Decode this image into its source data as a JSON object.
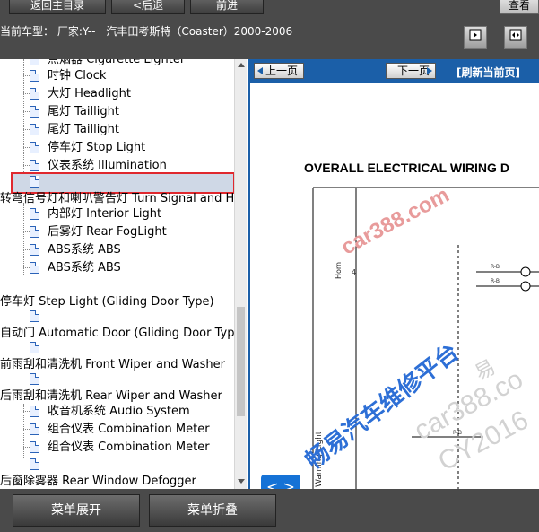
{
  "toolbar": {
    "home_label": "返回主目录",
    "back_label": "<后退",
    "forward_label": "前进",
    "view_label": "查看"
  },
  "vehicle": {
    "current_model": "当前车型： 厂家:Y--一汽丰田考斯特（Coaster）2000-2006"
  },
  "tree": {
    "items": [
      {
        "label": "点烟器 Cigarette Lighter"
      },
      {
        "label": "时钟 Clock"
      },
      {
        "label": "大灯 Headlight"
      },
      {
        "label": "尾灯 Taillight"
      },
      {
        "label": "尾灯 Taillight"
      },
      {
        "label": "停车灯 Stop Light"
      },
      {
        "label": "仪表系统 Illumination"
      },
      {
        "label": ""
      },
      {
        "label": "转弯信号灯和喇叭警告灯 Turn Signal and H"
      },
      {
        "label": "内部灯 Interior Light"
      },
      {
        "label": "后雾灯 Rear FogLight"
      },
      {
        "label": "ABS系统 ABS"
      },
      {
        "label": "ABS系统 ABS"
      },
      {
        "label": "停车灯 Step Light (Gliding Door Type)"
      },
      {
        "label": "自动门 Automatic Door (Gliding Door Type"
      },
      {
        "label": "前雨刮和清洗机 Front Wiper and Washer"
      },
      {
        "label": "后雨刮和清洗机 Rear Wiper and Washer"
      },
      {
        "label": "收音机系统 Audio System"
      },
      {
        "label": "组合仪表 Combination Meter"
      },
      {
        "label": "组合仪表 Combination Meter"
      },
      {
        "label": "后窗除雾器 Rear Window Defogger"
      }
    ]
  },
  "bottom": {
    "expand_label": "菜单展开",
    "collapse_label": "菜单折叠"
  },
  "viewer": {
    "prev_label": "上一页",
    "next_label": "下一页",
    "refresh_label": "[刷新当前页]",
    "diagram_title": "OVERALL ELECTRICAL WIRING D",
    "horn_label": "Horn",
    "warning_label": "Warning Light",
    "num_label": "4",
    "wire_rb": "R-B",
    "swap_label": "< >"
  },
  "watermarks": {
    "site1": "car388.com",
    "brand": "畅易汽车维修平台",
    "site2": "car388.co",
    "code": "CY2016",
    "yi": "易"
  },
  "colors": {
    "dark_bar": "#4a4a4a",
    "viewer_blue": "#1b5fa8",
    "highlight_border": "#e0282e",
    "watermark_red": "#e89b9b",
    "watermark_blue": "#2d6fd6"
  }
}
